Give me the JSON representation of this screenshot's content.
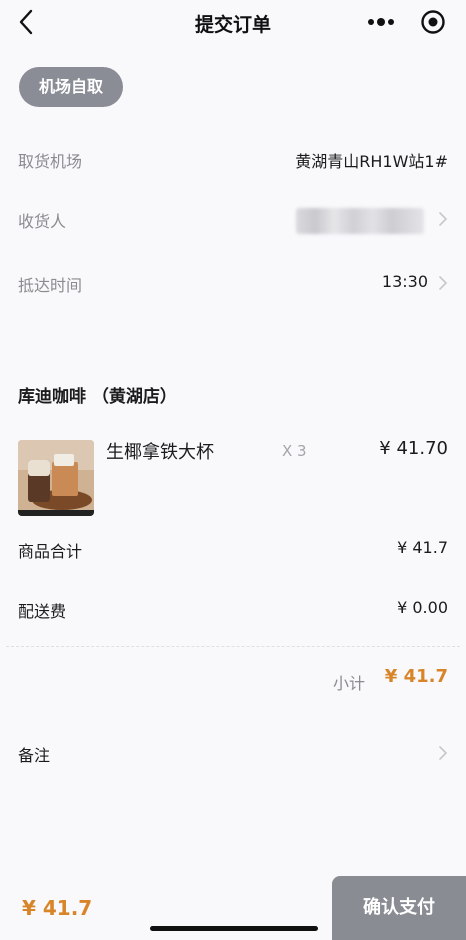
{
  "header": {
    "title": "提交订单"
  },
  "delivery_mode": "机场自取",
  "info_rows": [
    {
      "label": "取货机场",
      "value": "黄湖青山RH1W站1#"
    },
    {
      "label": "收货人",
      "value": ""
    },
    {
      "label": "抵达时间",
      "value": "13:30"
    }
  ],
  "shop_name": "库迪咖啡 （黄湖店）",
  "product": {
    "name": "生椰拿铁大杯",
    "qty": "X 3",
    "price": "¥ 41.70"
  },
  "summary": [
    {
      "label": "商品合计",
      "value": "¥ 41.7"
    },
    {
      "label": "配送费",
      "value": "¥ 0.00"
    }
  ],
  "subtotal": {
    "label": "小计",
    "value": "¥ 41.7"
  },
  "remark_label": "备注",
  "footer": {
    "total": "¥ 41.7",
    "pay_label": "确认支付"
  },
  "colors": {
    "accent": "#d8852a",
    "button": "#8a8c94",
    "background": "#f9f8fb"
  },
  "icons": [
    "back-icon",
    "more-icon",
    "target-icon",
    "chevron-right-icon"
  ]
}
